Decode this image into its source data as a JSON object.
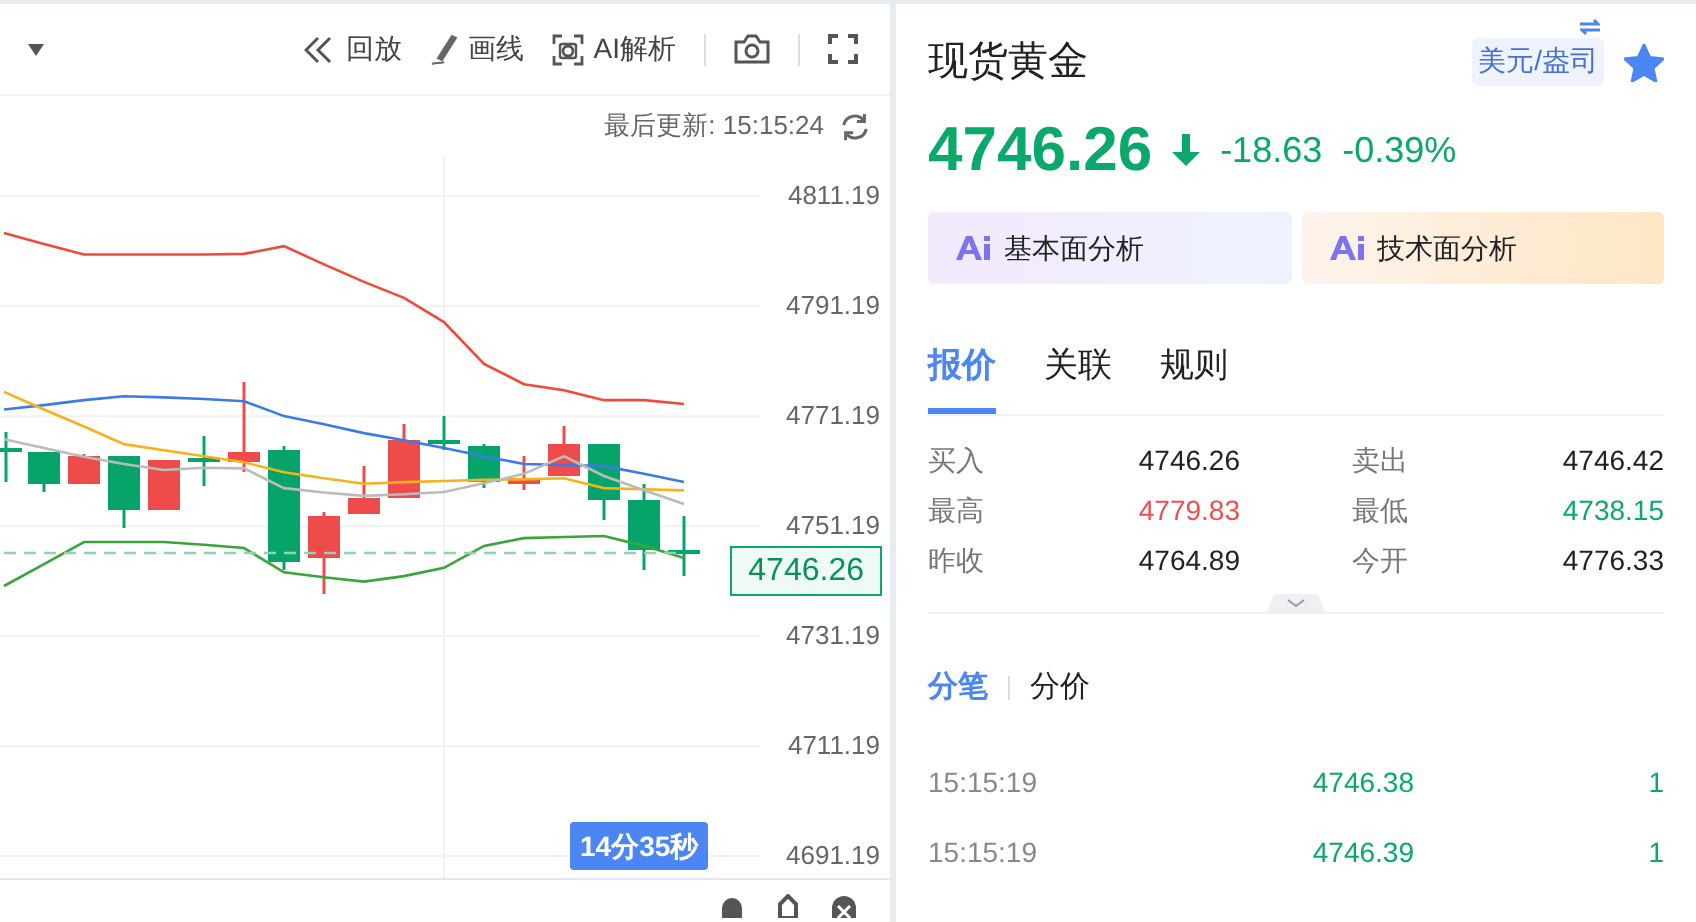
{
  "toolbar": {
    "items": [
      {
        "kind": "replay",
        "label": "回放"
      },
      {
        "kind": "draw",
        "label": "画线"
      },
      {
        "kind": "ai",
        "label": "AI解析"
      }
    ]
  },
  "last_update": "最后更新: 15:15:24",
  "chart": {
    "chart_data": {
      "type": "line",
      "grid": true,
      "ylim": [
        4687.2,
        4818.5
      ],
      "yticks": [
        4811.19,
        4791.19,
        4771.19,
        4751.19,
        4731.19,
        4711.19,
        4691.19
      ],
      "series": [
        {
          "color": "#ef4a3c",
          "values": [
            4804.5,
            4802.5,
            4800.6,
            4800.6,
            4800.6,
            4800.6,
            4800.7,
            4802.1,
            4798.8,
            4795.6,
            4792.7,
            4788.3,
            4780.7,
            4777.0,
            4775.9,
            4774.1,
            4774.1,
            4773.4
          ]
        },
        {
          "color": "#3b7be8",
          "values": [
            4772.4,
            4773.2,
            4774.1,
            4774.8,
            4774.6,
            4774.3,
            4773.9,
            4771.2,
            4769.7,
            4768.1,
            4766.8,
            4765.4,
            4763.9,
            4762.5,
            4762.3,
            4762.1,
            4760.7,
            4759.2
          ]
        },
        {
          "color": "#f5b21b",
          "values": [
            4775.6,
            4772.4,
            4769.3,
            4766.1,
            4765.0,
            4763.9,
            4762.8,
            4761.0,
            4759.9,
            4758.9,
            4759.2,
            4759.4,
            4759.6,
            4759.7,
            4759.9,
            4758.1,
            4757.9,
            4757.7
          ]
        },
        {
          "color": "#bbbbbb",
          "values": [
            4767.0,
            4765.4,
            4763.8,
            4762.5,
            4761.4,
            4761.8,
            4761.7,
            4758.1,
            4757.3,
            4756.7,
            4757.0,
            4757.4,
            4759.0,
            4760.7,
            4763.9,
            4760.3,
            4757.7,
            4755.2
          ]
        },
        {
          "color": "#3aa53a",
          "values": [
            4740.3,
            4744.3,
            4748.3,
            4748.3,
            4748.3,
            4747.8,
            4747.2,
            4742.8,
            4741.9,
            4741.1,
            4742.1,
            4743.6,
            4747.6,
            4749.0,
            4749.2,
            4749.4,
            4747.6,
            4745.4
          ]
        },
        {
          "color": "#8fd3b3",
          "line_style": "dashed",
          "values": [
            4746.3,
            4746.3,
            4746.3,
            4746.3,
            4746.3,
            4746.3,
            4746.3,
            4746.3,
            4746.3,
            4746.3,
            4746.3,
            4746.3,
            4746.3,
            4746.3,
            4746.3,
            4746.3,
            4746.3,
            4746.3
          ]
        }
      ]
    },
    "current_price_tag": "4746.26",
    "countdown": "14分35秒"
  },
  "quote": {
    "title": "现货黄金",
    "unit": "美元/盎司",
    "favorited": true,
    "price": "4746.26",
    "falling": true,
    "change": "-18.63",
    "change_percent": "-0.39%"
  },
  "analysis_buttons": [
    {
      "kind": "fundamental",
      "label": "基本面分析"
    },
    {
      "kind": "technical",
      "label": "技术面分析"
    }
  ],
  "tabs": [
    {
      "label": "报价",
      "selected": true
    },
    {
      "label": "关联",
      "selected": false
    },
    {
      "label": "规则",
      "selected": false
    }
  ],
  "stats": [
    {
      "label": "买入",
      "value": "4746.26",
      "color": "#222222"
    },
    {
      "label": "卖出",
      "value": "4746.42",
      "color": "#222222"
    },
    {
      "label": "最高",
      "value": "4779.83",
      "color": "#f04e4e"
    },
    {
      "label": "最低",
      "value": "4738.15",
      "color": "#0aa86a"
    },
    {
      "label": "昨收",
      "value": "4764.89",
      "color": "#222222"
    },
    {
      "label": "今开",
      "value": "4776.33",
      "color": "#222222"
    }
  ],
  "trade_tabs": [
    {
      "label": "分笔",
      "selected": true
    },
    {
      "label": "分价",
      "selected": false
    }
  ],
  "trades": [
    {
      "time": "15:15:19",
      "price": "4746.38",
      "volume": "1"
    },
    {
      "time": "15:15:19",
      "price": "4746.39",
      "volume": "1"
    }
  ]
}
